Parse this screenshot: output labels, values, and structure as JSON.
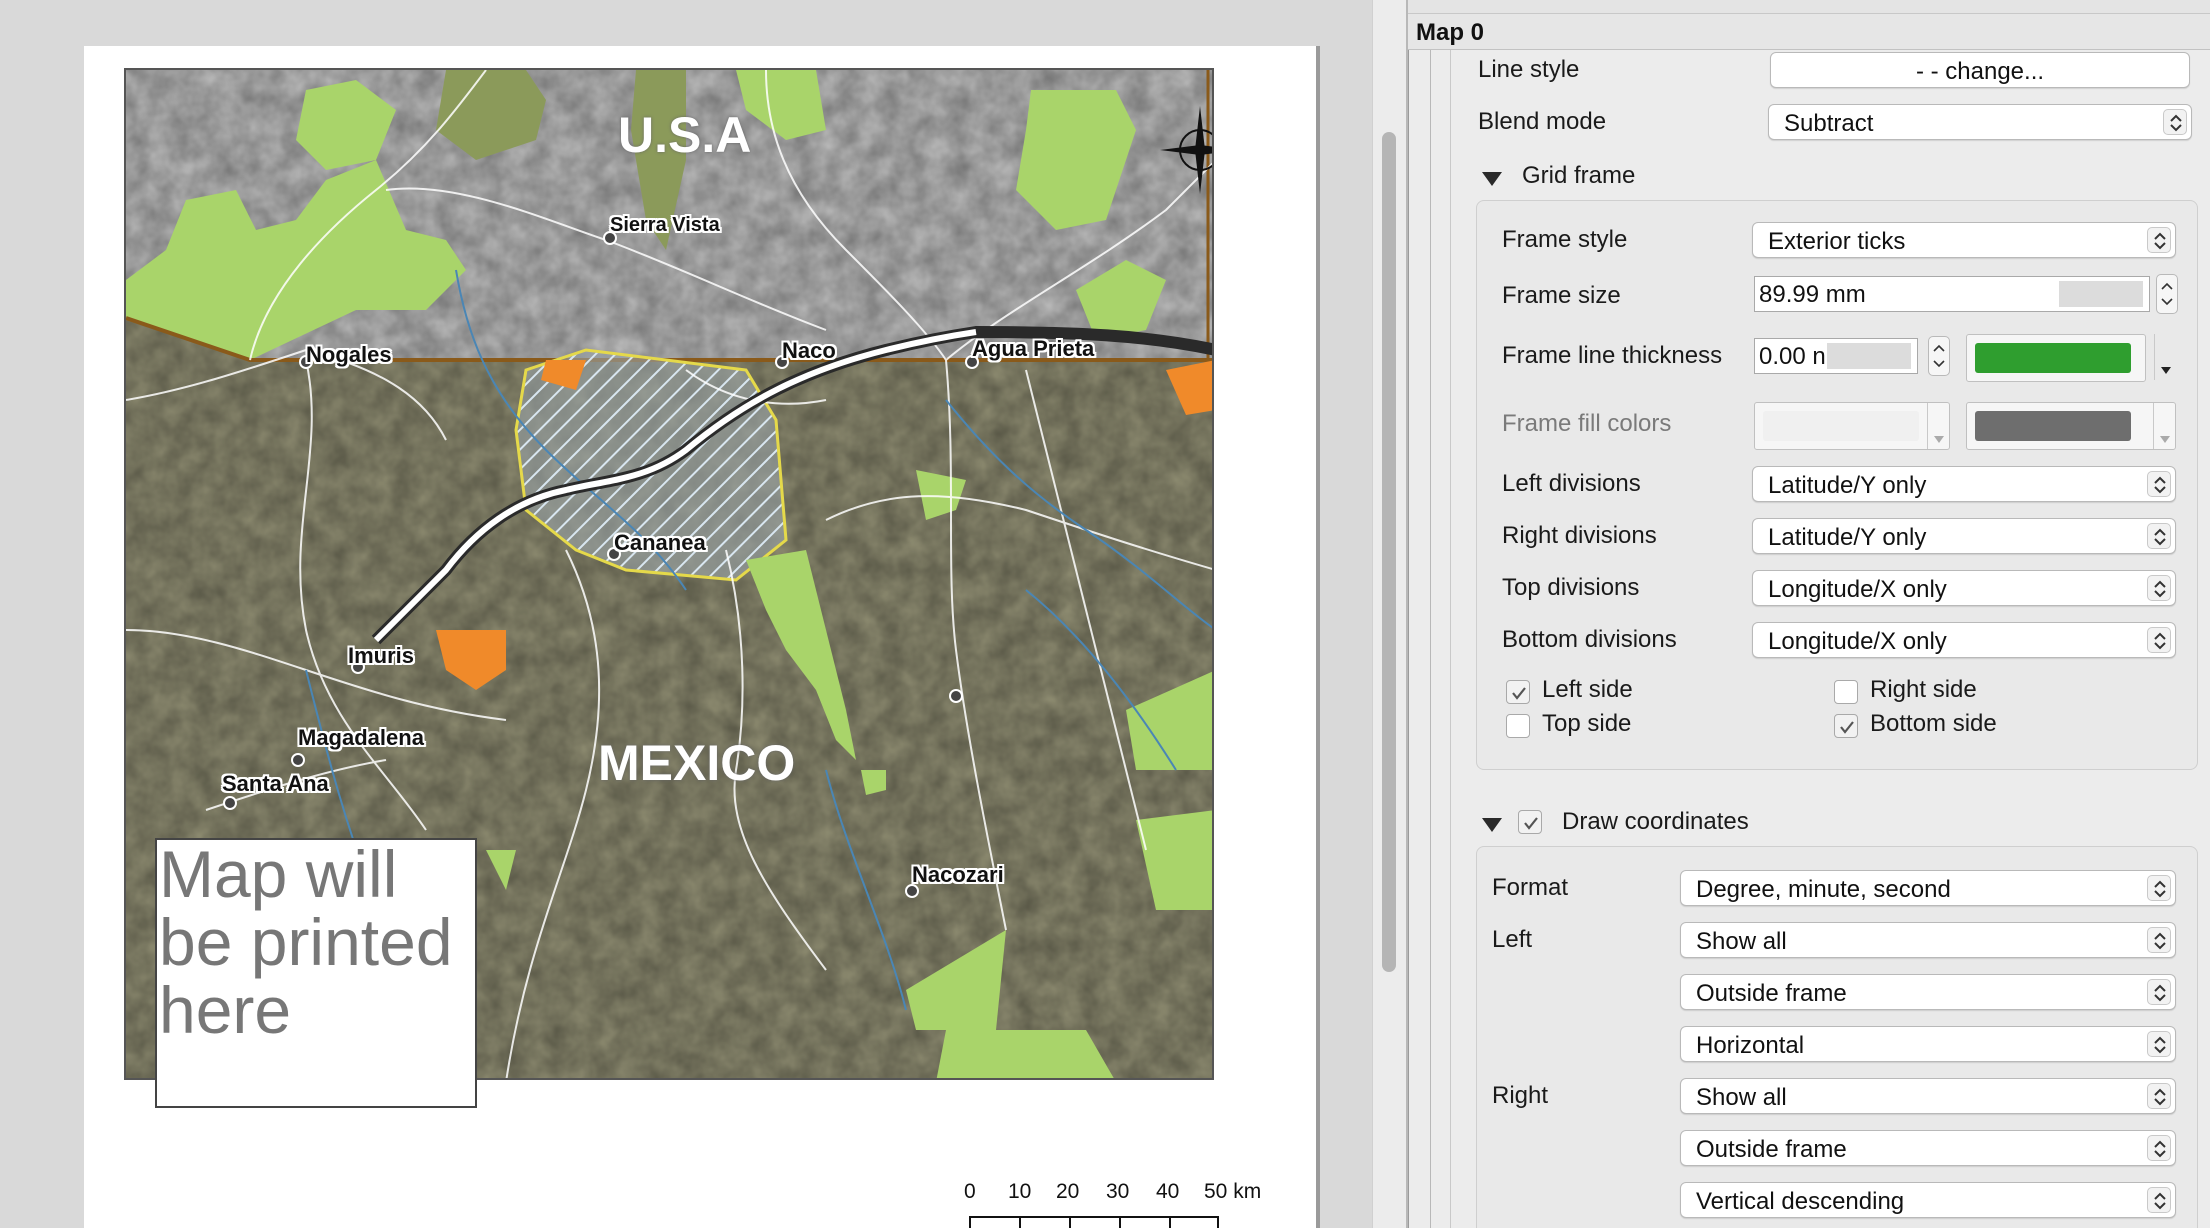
{
  "map_canvas": {
    "country_labels": [
      "U.S.A",
      "MEXICO"
    ],
    "places": [
      "Sierra Vista",
      "Nogales",
      "Naco",
      "Agua Prieta",
      "Cananea",
      "Imuris",
      "Magadalena",
      "Santa Ana",
      "Nacozari"
    ],
    "placeholder_lines": [
      "Map will",
      "be printed",
      "here"
    ],
    "scalebar": {
      "ticks": [
        "0",
        "10",
        "20",
        "30",
        "40",
        "50 km"
      ]
    },
    "colors": {
      "usa_relief": "#bdbdbd",
      "mexico_relief": "#8f8d72",
      "parkland": "#a9d46a",
      "dark_park": "#8b9a5a",
      "orange_zone": "#f08a2a",
      "border": "#8a5a1a",
      "route": "#ffffff",
      "rivers": "#4a86b5"
    }
  },
  "panel": {
    "title": "Map 0",
    "line_style": {
      "label": "Line style",
      "button": "- - change..."
    },
    "blend_mode": {
      "label": "Blend mode",
      "value": "Subtract"
    },
    "grid_frame": {
      "section": "Grid frame",
      "frame_style": {
        "label": "Frame style",
        "value": "Exterior ticks"
      },
      "frame_size": {
        "label": "Frame size",
        "value": "89.99 mm"
      },
      "frame_line_thickness": {
        "label": "Frame line thickness",
        "value": "0.00 n",
        "color": "#2f9e2f"
      },
      "frame_fill_colors": {
        "label": "Frame fill colors",
        "color1": "#f0f0f0",
        "color2": "#6e6e6e"
      },
      "left_divisions": {
        "label": "Left divisions",
        "value": "Latitude/Y only"
      },
      "right_divisions": {
        "label": "Right divisions",
        "value": "Latitude/Y only"
      },
      "top_divisions": {
        "label": "Top divisions",
        "value": "Longitude/X only"
      },
      "bottom_divisions": {
        "label": "Bottom divisions",
        "value": "Longitude/X only"
      },
      "sides": {
        "left_side": {
          "label": "Left side",
          "checked": true
        },
        "right_side": {
          "label": "Right side",
          "checked": false
        },
        "top_side": {
          "label": "Top side",
          "checked": false
        },
        "bottom_side": {
          "label": "Bottom side",
          "checked": true
        }
      }
    },
    "draw_coordinates": {
      "section": "Draw coordinates",
      "checked": true,
      "format": {
        "label": "Format",
        "value": "Degree, minute, second"
      },
      "left": {
        "label": "Left",
        "show": "Show all",
        "position": "Outside frame",
        "direction": "Horizontal"
      },
      "right": {
        "label": "Right",
        "show": "Show all",
        "position": "Outside frame",
        "direction": "Vertical descending"
      }
    }
  }
}
